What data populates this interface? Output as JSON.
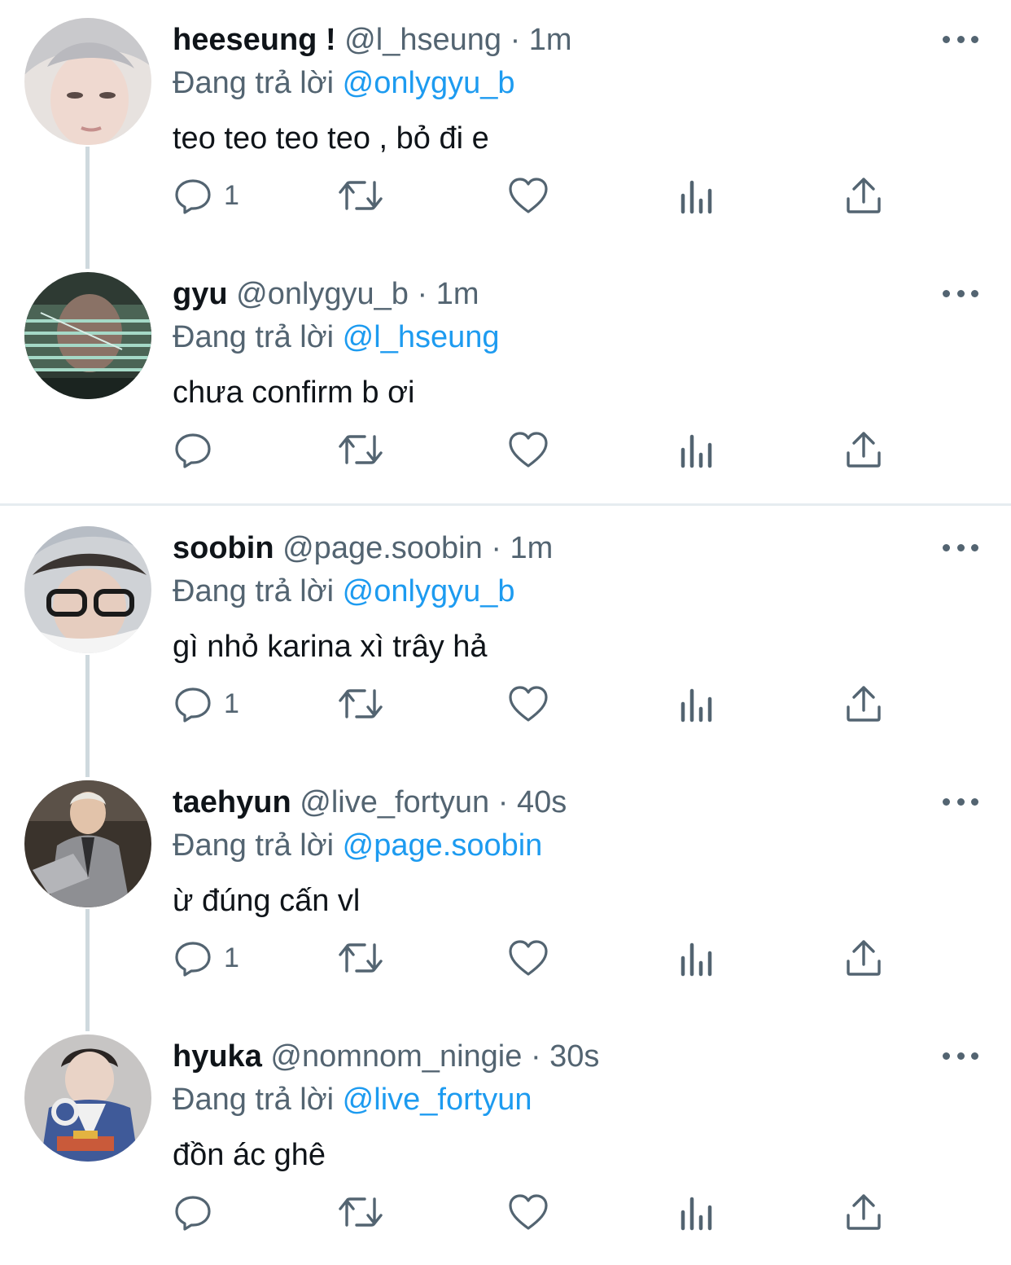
{
  "tweets": [
    {
      "name": "heeseung !",
      "handle": "@l_hseung",
      "dot": "·",
      "time": "1m",
      "reply_prefix": "Đang trả lời",
      "reply_to": "@onlygyu_b",
      "text": "teo teo teo teo , bỏ đi e",
      "reply_count": "1"
    },
    {
      "name": "gyu",
      "handle": "@onlygyu_b",
      "dot": "·",
      "time": "1m",
      "reply_prefix": "Đang trả lời",
      "reply_to": "@l_hseung",
      "text": "chưa confirm b ơi",
      "reply_count": ""
    },
    {
      "name": "soobin",
      "handle": "@page.soobin",
      "dot": "·",
      "time": "1m",
      "reply_prefix": "Đang trả lời",
      "reply_to": "@onlygyu_b",
      "text": "gì nhỏ karina xì trây hả",
      "reply_count": "1"
    },
    {
      "name": "taehyun",
      "handle": "@live_fortyun",
      "dot": "·",
      "time": "40s",
      "reply_prefix": "Đang trả lời",
      "reply_to": "@page.soobin",
      "text": "ừ đúng cấn vl",
      "reply_count": "1"
    },
    {
      "name": "hyuka",
      "handle": "@nomnom_ningie",
      "dot": "·",
      "time": "30s",
      "reply_prefix": "Đang trả lời",
      "reply_to": "@live_fortyun",
      "text": "đồn ác ghê",
      "reply_count": ""
    }
  ],
  "colors": {
    "text": "#0f1419",
    "secondary": "#536471",
    "mention": "#1d9bf0",
    "thread_line": "#cfd9de",
    "separator": "#e6ecf0"
  },
  "icons": [
    "reply-icon",
    "retweet-icon",
    "like-icon",
    "views-icon",
    "share-icon",
    "more-icon"
  ]
}
